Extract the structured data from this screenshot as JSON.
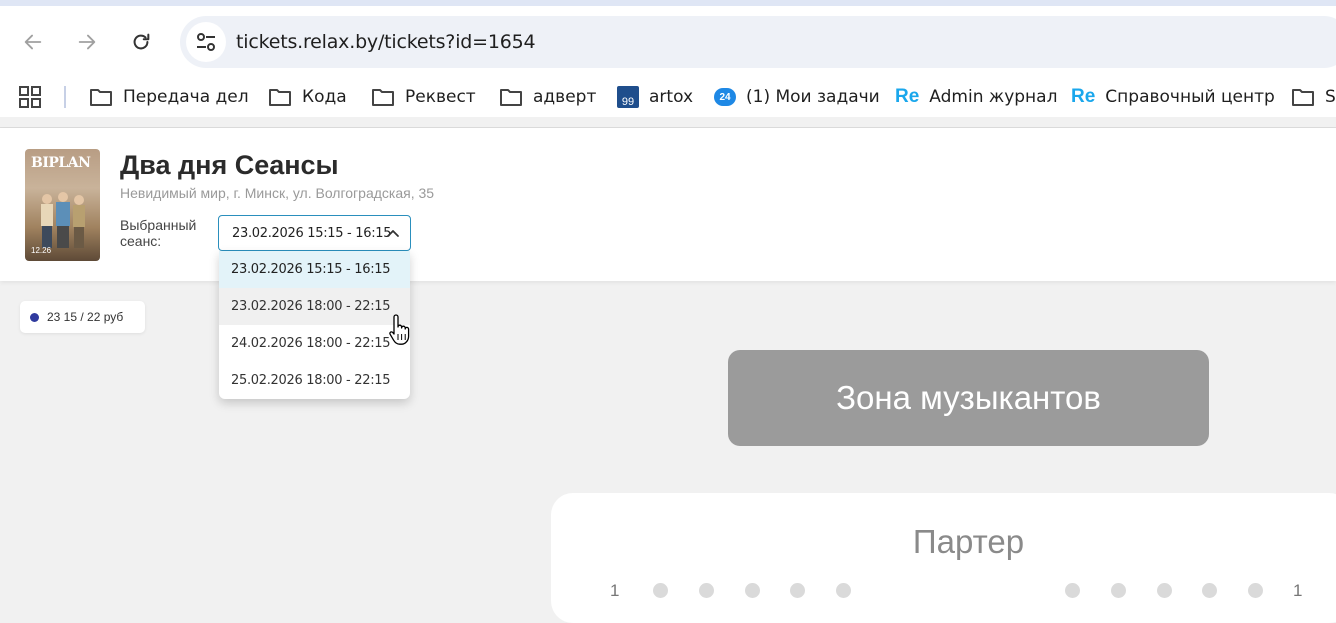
{
  "browser": {
    "url": "tickets.relax.by/tickets?id=1654",
    "bookmarks": [
      {
        "label": "Передача дел",
        "icon": "folder-icon"
      },
      {
        "label": "Кода",
        "icon": "folder-icon"
      },
      {
        "label": "Реквест",
        "icon": "folder-icon"
      },
      {
        "label": "адверт",
        "icon": "folder-icon"
      },
      {
        "label": "artox",
        "icon": "99-icon",
        "badge": "99"
      },
      {
        "label": "(1) Мои задачи",
        "icon": "bitrix24-icon",
        "badge": "24"
      },
      {
        "label": "Admin журнал",
        "icon": "re-icon",
        "badge": "Re"
      },
      {
        "label": "Справочный центр",
        "icon": "re-icon",
        "badge": "Re"
      },
      {
        "label": "S",
        "icon": "folder-icon"
      }
    ]
  },
  "event": {
    "poster_title": "BIPLAN",
    "poster_date": "12.26",
    "title": "Два дня Сеансы",
    "venue": "Невидимый мир, г. Минск, ул. Волгоградская, 35",
    "session_label": "Выбранный сеанс:",
    "selected_session": "23.02.2026 15:15 - 16:15",
    "sessions": [
      "23.02.2026 15:15 - 16:15",
      "23.02.2026 18:00 - 22:15",
      "24.02.2026 18:00 - 22:15",
      "25.02.2026 18:00 - 22:15"
    ]
  },
  "legend": {
    "label": "23 15 / 22 руб",
    "color": "#2f3a9e"
  },
  "hall": {
    "stage_label": "Зона музыкантов",
    "section_title": "Партер",
    "row_left": "1",
    "row_right": "1"
  },
  "colors": {
    "accent": "#2a8fbd",
    "selected_option_bg": "#e3f3f9",
    "stage_bg": "#9b9b9b"
  }
}
